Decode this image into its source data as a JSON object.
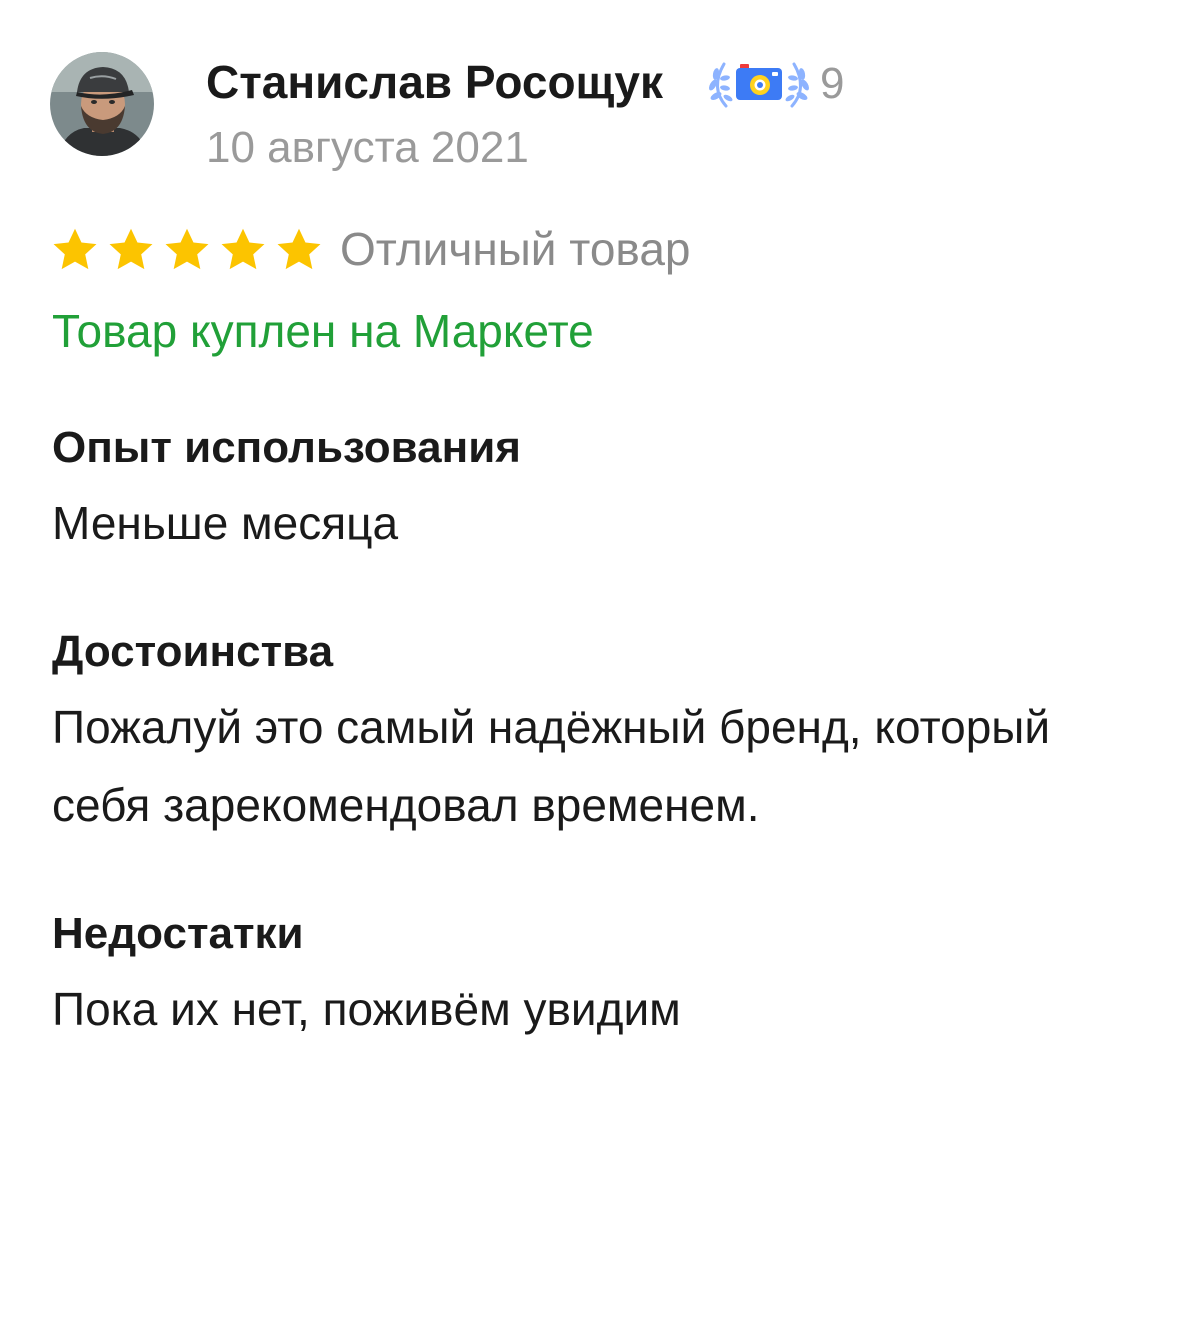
{
  "review": {
    "author": {
      "name": "Станислав Росощук",
      "badge_icon": "camera-laurel-badge-icon",
      "badge_count": "9"
    },
    "date": "10 августа 2021",
    "rating": {
      "stars": 5,
      "max_stars": 5,
      "label": "Отличный товар",
      "star_color": "#fcc400"
    },
    "purchase_note": "Товар куплен на Маркете",
    "sections": [
      {
        "heading": "Опыт использования",
        "text": "Меньше месяца"
      },
      {
        "heading": "Достоинства",
        "text": "Пожалуй это самый надёжный бренд, который себя зарекомендовал временем."
      },
      {
        "heading": "Недостатки",
        "text": "Пока их нет, поживём увидим"
      }
    ]
  },
  "colors": {
    "accent_green": "#21a038",
    "muted_text": "#9a9a9a",
    "badge_blue": "#3d7bf5"
  }
}
